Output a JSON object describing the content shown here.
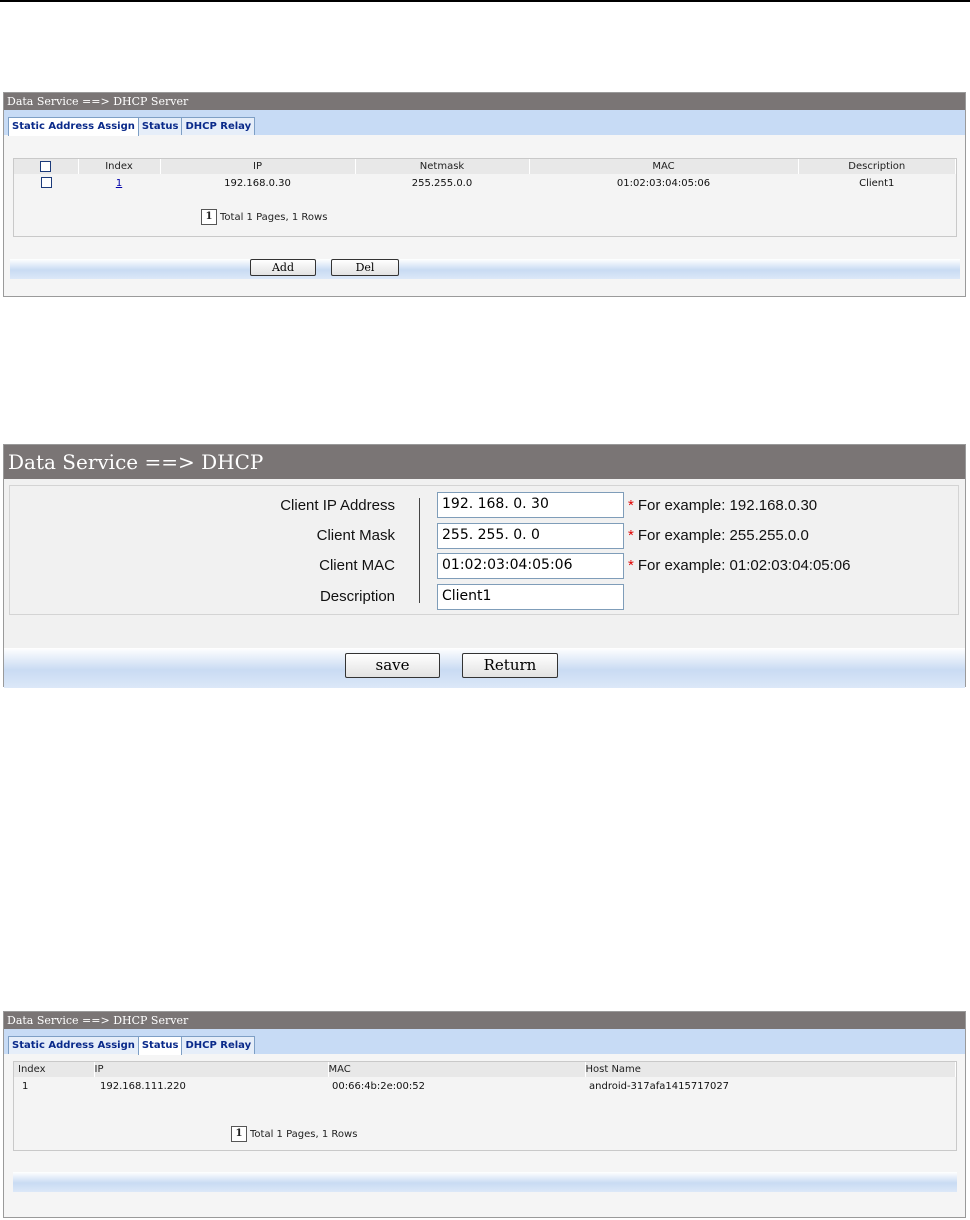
{
  "panel1": {
    "title": "Data Service ==> DHCP Server",
    "tabs": [
      "Static Address Assign",
      "Status",
      "DHCP Relay"
    ],
    "columns": [
      "Index",
      "IP",
      "Netmask",
      "MAC",
      "Description"
    ],
    "rows": [
      {
        "index": "1",
        "ip": "192.168.0.30",
        "netmask": "255.255.0.0",
        "mac": "01:02:03:04:05:06",
        "description": "Client1"
      }
    ],
    "page_number": "1",
    "pager_text": "Total 1 Pages, 1 Rows",
    "add_label": "Add",
    "del_label": "Del"
  },
  "panel2": {
    "title": "Data Service ==> DHCP",
    "fields": [
      {
        "label": "Client IP Address",
        "value": "192. 168. 0. 30",
        "hint": "For example: 192.168.0.30"
      },
      {
        "label": "Client Mask",
        "value": "255. 255. 0. 0",
        "hint": "For example: 255.255.0.0"
      },
      {
        "label": "Client MAC",
        "value": "01:02:03:04:05:06",
        "hint": "For example: 01:02:03:04:05:06"
      },
      {
        "label": "Description",
        "value": "Client1",
        "hint": ""
      }
    ],
    "required_mark": "*",
    "save_label": "save",
    "return_label": "Return"
  },
  "panel3": {
    "title": "Data Service ==> DHCP Server",
    "tabs": [
      "Static Address Assign",
      "Status",
      "DHCP Relay"
    ],
    "columns": [
      "Index",
      "IP",
      "MAC",
      "Host Name"
    ],
    "rows": [
      {
        "index": "1",
        "ip": "192.168.111.220",
        "mac": "00:66:4b:2e:00:52",
        "host": "android-317afa1415717027"
      }
    ],
    "page_number": "1",
    "pager_text": "Total 1 Pages, 1 Rows"
  }
}
